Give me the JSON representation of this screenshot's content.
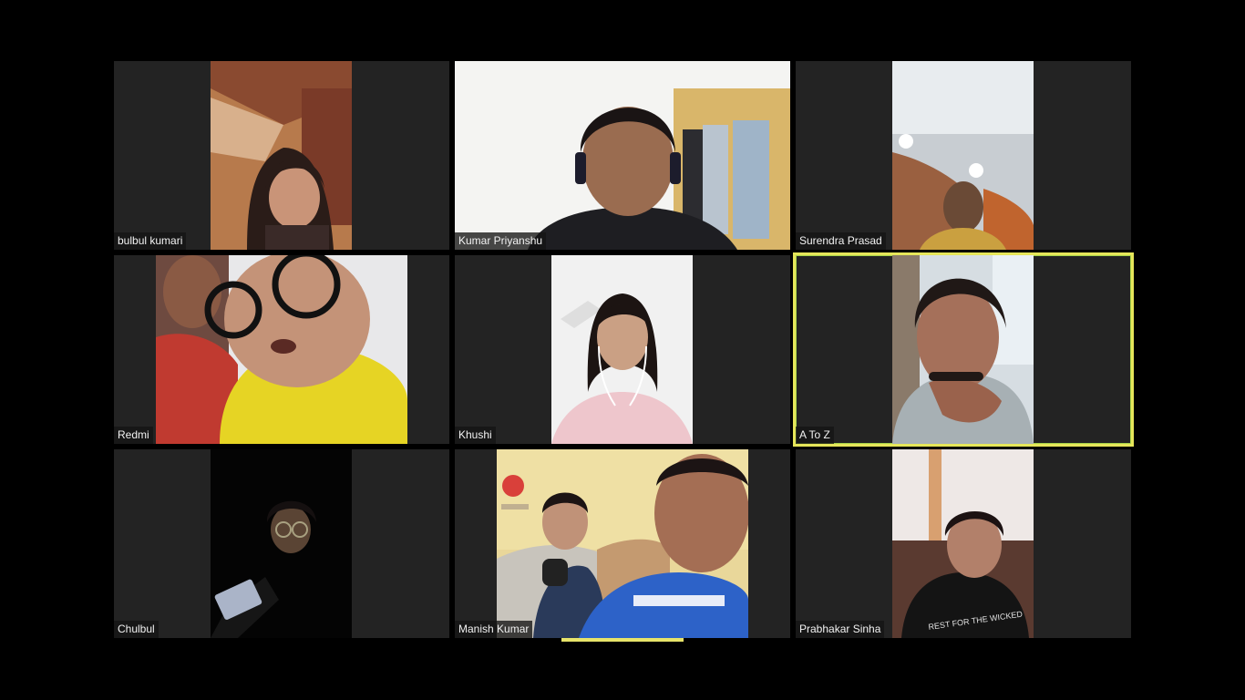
{
  "meeting": {
    "participants": [
      {
        "name": "bulbul kumari",
        "active": false
      },
      {
        "name": "Kumar Priyanshu",
        "active": false
      },
      {
        "name": "Surendra Prasad",
        "active": false
      },
      {
        "name": "Redmi",
        "active": false
      },
      {
        "name": "Khushi",
        "active": false
      },
      {
        "name": "A To Z",
        "active": true
      },
      {
        "name": "Chulbul",
        "active": false
      },
      {
        "name": "Manish Kumar",
        "active": false
      },
      {
        "name": "Prabhakar Sinha",
        "active": false
      }
    ]
  },
  "colors": {
    "background": "#000000",
    "tile_background": "#232323",
    "active_speaker_border": "#e6e65a",
    "page_indicator": "#e8e46a"
  }
}
